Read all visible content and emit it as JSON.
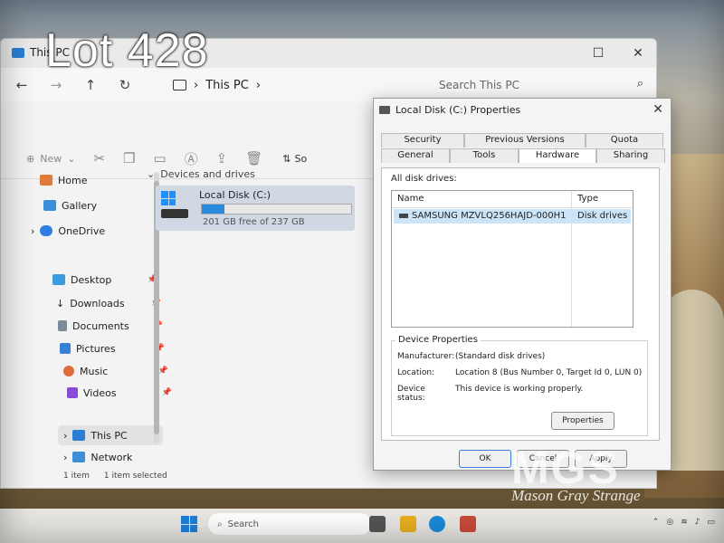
{
  "overlay": {
    "lot_label": "Lot 428",
    "watermark_logo": "MGS",
    "watermark_text": "Mason Gray Strange"
  },
  "explorer": {
    "tab_title": "This PC",
    "address_crumb": "This PC",
    "search_placeholder": "Search This PC",
    "toolbar": {
      "new_label": "New",
      "sort_label": "So"
    },
    "sidebar": {
      "home": "Home",
      "gallery": "Gallery",
      "onedrive": "OneDrive",
      "desktop": "Desktop",
      "downloads": "Downloads",
      "documents": "Documents",
      "pictures": "Pictures",
      "music": "Music",
      "videos": "Videos",
      "thispc": "This PC",
      "network": "Network"
    },
    "group_header": "Devices and drives",
    "drive": {
      "name": "Local Disk (C:)",
      "free_text": "201 GB free of 237 GB",
      "used_fraction": 0.152
    },
    "status": {
      "count": "1 item",
      "selected": "1 item selected"
    }
  },
  "dialog": {
    "title": "Local Disk (C:) Properties",
    "tabs_top": [
      "Security",
      "Previous Versions",
      "Quota"
    ],
    "tabs_bottom": [
      "General",
      "Tools",
      "Hardware",
      "Sharing"
    ],
    "active_tab": "Hardware",
    "all_disk_drives_label": "All disk drives:",
    "columns": {
      "name": "Name",
      "type": "Type"
    },
    "row": {
      "name": "SAMSUNG MZVLQ256HAJD-000H1",
      "type": "Disk drives"
    },
    "device_props_label": "Device Properties",
    "manufacturer_label": "Manufacturer:",
    "manufacturer": "(Standard disk drives)",
    "location_label": "Location:",
    "location": "Location 8 (Bus Number 0, Target Id 0, LUN 0)",
    "status_label": "Device status:",
    "status": "This device is working properly.",
    "properties_button": "Properties",
    "ok_button": "OK",
    "cancel_button": "Cancel",
    "apply_button": "Apply"
  },
  "taskbar": {
    "search_label": "Search"
  }
}
